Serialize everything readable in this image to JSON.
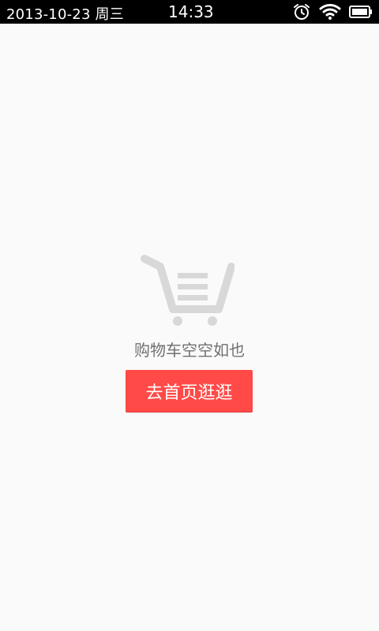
{
  "status_bar": {
    "date": "2013-10-23 周三",
    "time": "14:33",
    "icons": [
      "alarm-icon",
      "wifi-icon",
      "battery-icon"
    ],
    "background": "#000000",
    "text_color": "#ffffff"
  },
  "empty_cart": {
    "icon": "shopping-cart-icon",
    "message": "购物车空空如也",
    "button_label": "去首页逛逛",
    "button_color": "#ff4a48",
    "icon_color": "#d8d8d8",
    "message_color": "#707070"
  },
  "page": {
    "background": "#fafafa"
  }
}
